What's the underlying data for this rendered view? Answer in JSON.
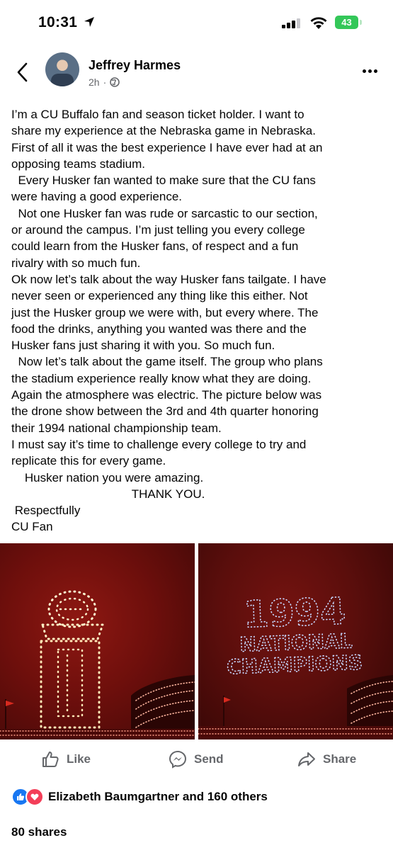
{
  "status_bar": {
    "time": "10:31",
    "battery": "43"
  },
  "post": {
    "author": "Jeffrey Harmes",
    "time_ago": "2h",
    "dot": "·",
    "lines": [
      "I’m a CU Buffalo fan and season ticket holder. I want to",
      "share my experience at the Nebraska game in Nebraska.",
      "First of all it was the best experience I have ever had at an",
      "opposing teams stadium.",
      "  Every Husker fan wanted to make sure that the CU fans",
      "were having a good experience.",
      "  Not one Husker fan was rude or sarcastic to our section,",
      "or around the campus. I’m just telling you every college",
      "could learn from the Husker fans, of respect and a fun",
      "rivalry with so much fun.",
      "Ok now let’s talk about the way Husker fans tailgate. I have",
      "never seen or experienced any thing like this either. Not",
      "just the Husker group we were with, but every where. The",
      "food the drinks, anything you wanted was there and the",
      "Husker fans just sharing it with you. So much fun.",
      "  Now let’s talk about the game itself. The group who plans",
      "the stadium experience really know what they are doing.",
      "Again the atmosphere was electric. The picture below was",
      "the drone show between the 3rd and 4th quarter honoring",
      "their 1994 national championship team.",
      "I must say it’s time to challenge every college to try and",
      "replicate this for every game.",
      "    Husker nation you were amazing.",
      "                                    THANK YOU.",
      " Respectfully",
      "CU Fan"
    ],
    "photo2_year": "1994",
    "photo2_line2": "NATIONAL",
    "photo2_line3": "CHAMPIONS"
  },
  "actions": {
    "like": "Like",
    "send": "Send",
    "share": "Share"
  },
  "footer": {
    "reactions_text": "Elizabeth Baumgartner and 160 others",
    "shares_text": "80 shares"
  },
  "icons": [
    "location-arrow-icon",
    "signal-icon",
    "wifi-icon",
    "battery-icon",
    "back-chevron-icon",
    "globe-icon",
    "more-dots-icon",
    "like-icon",
    "messenger-icon",
    "share-icon",
    "reaction-like-icon",
    "reaction-love-icon"
  ]
}
